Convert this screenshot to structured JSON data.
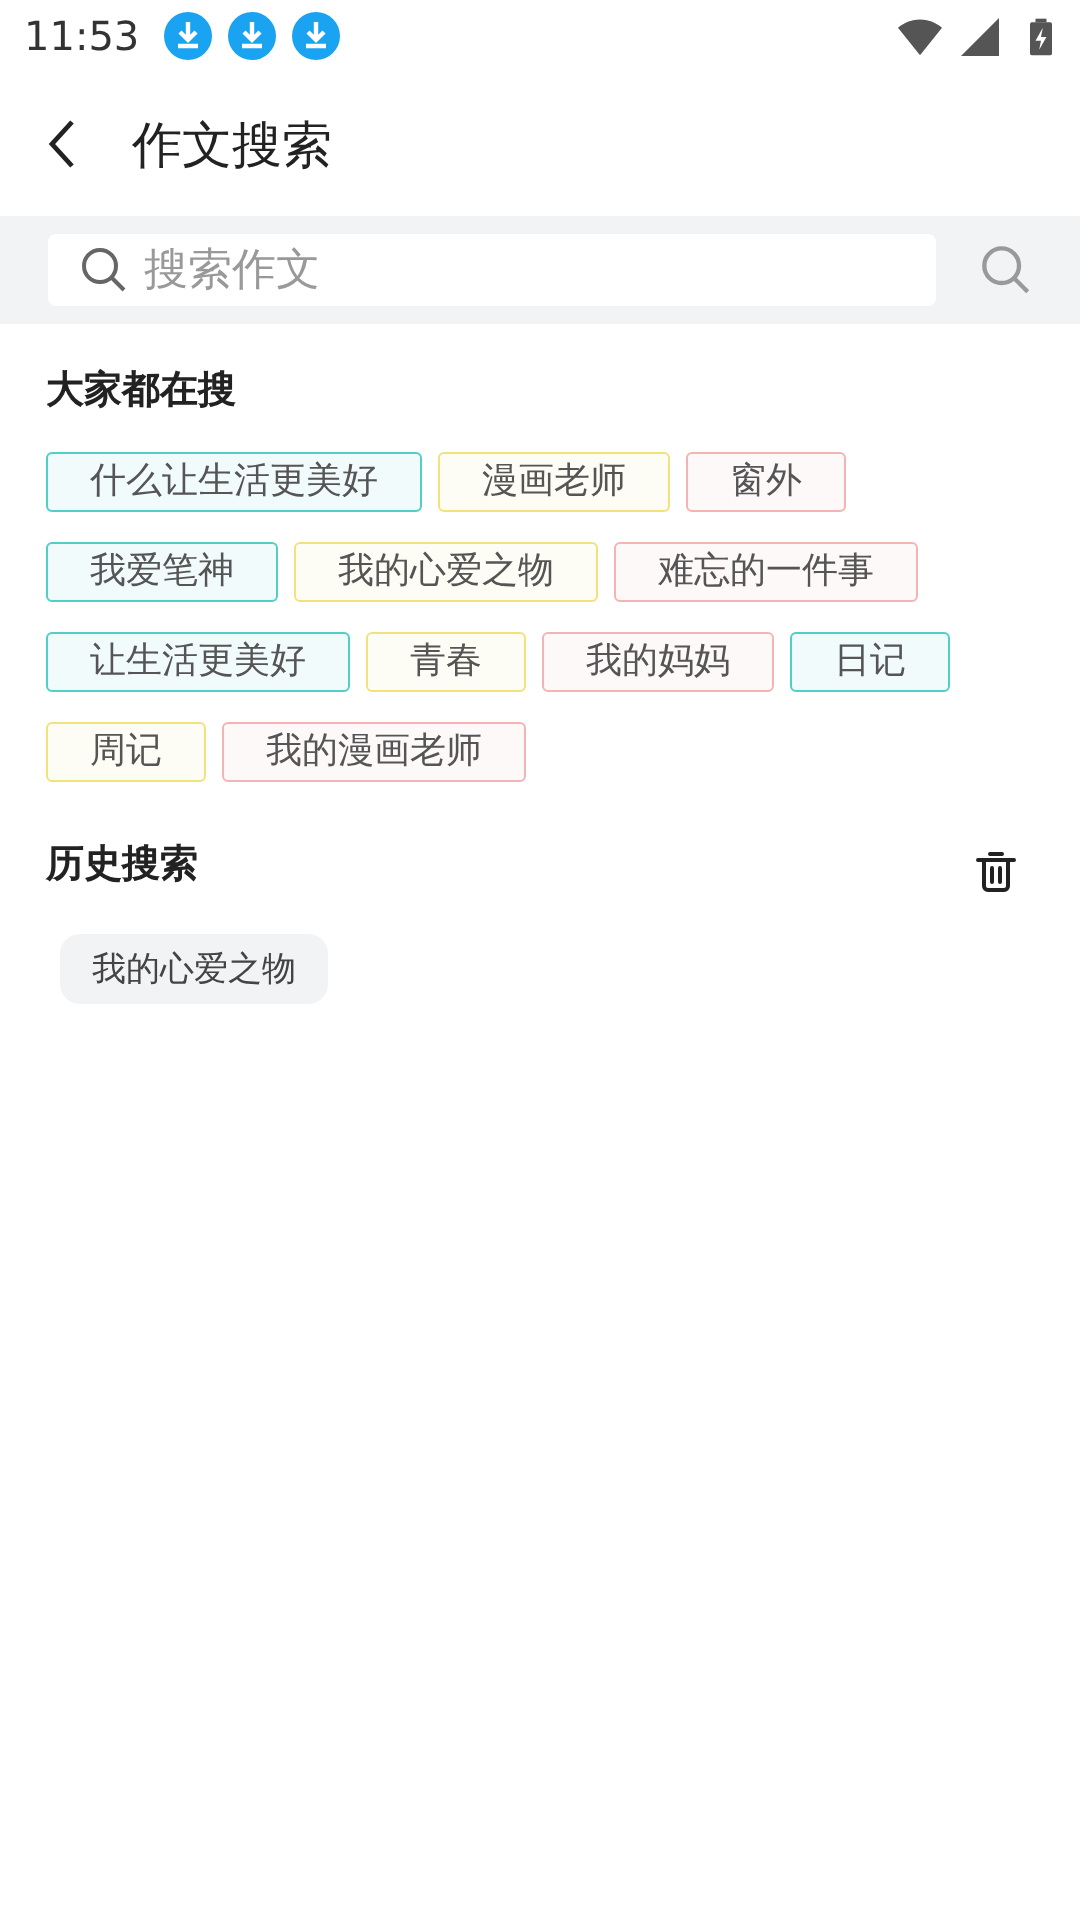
{
  "status_bar": {
    "time": "11:53",
    "notifications": [
      {
        "kind": "download"
      },
      {
        "kind": "download"
      },
      {
        "kind": "download"
      }
    ]
  },
  "header": {
    "title": "作文搜索"
  },
  "search": {
    "placeholder": "搜索作文"
  },
  "hot": {
    "title": "大家都在搜",
    "tags": [
      {
        "label": "什么让生活更美好",
        "color": "#4fcfc6"
      },
      {
        "label": "漫画老师",
        "color": "#f3e27c"
      },
      {
        "label": "窗外",
        "color": "#f5b4b4"
      },
      {
        "label": "我爱笔神",
        "color": "#4fcfc6"
      },
      {
        "label": "我的心爱之物",
        "color": "#f3e27c"
      },
      {
        "label": "难忘的一件事",
        "color": "#f5b4b4"
      },
      {
        "label": "让生活更美好",
        "color": "#4fcfc6"
      },
      {
        "label": "青春",
        "color": "#f3e27c"
      },
      {
        "label": "我的妈妈",
        "color": "#f5b4b4"
      },
      {
        "label": "日记",
        "color": "#4fcfc6"
      },
      {
        "label": "周记",
        "color": "#f3e27c"
      },
      {
        "label": "我的漫画老师",
        "color": "#f5b4b4"
      }
    ]
  },
  "history": {
    "title": "历史搜索",
    "items": [
      "我的心爱之物"
    ]
  }
}
